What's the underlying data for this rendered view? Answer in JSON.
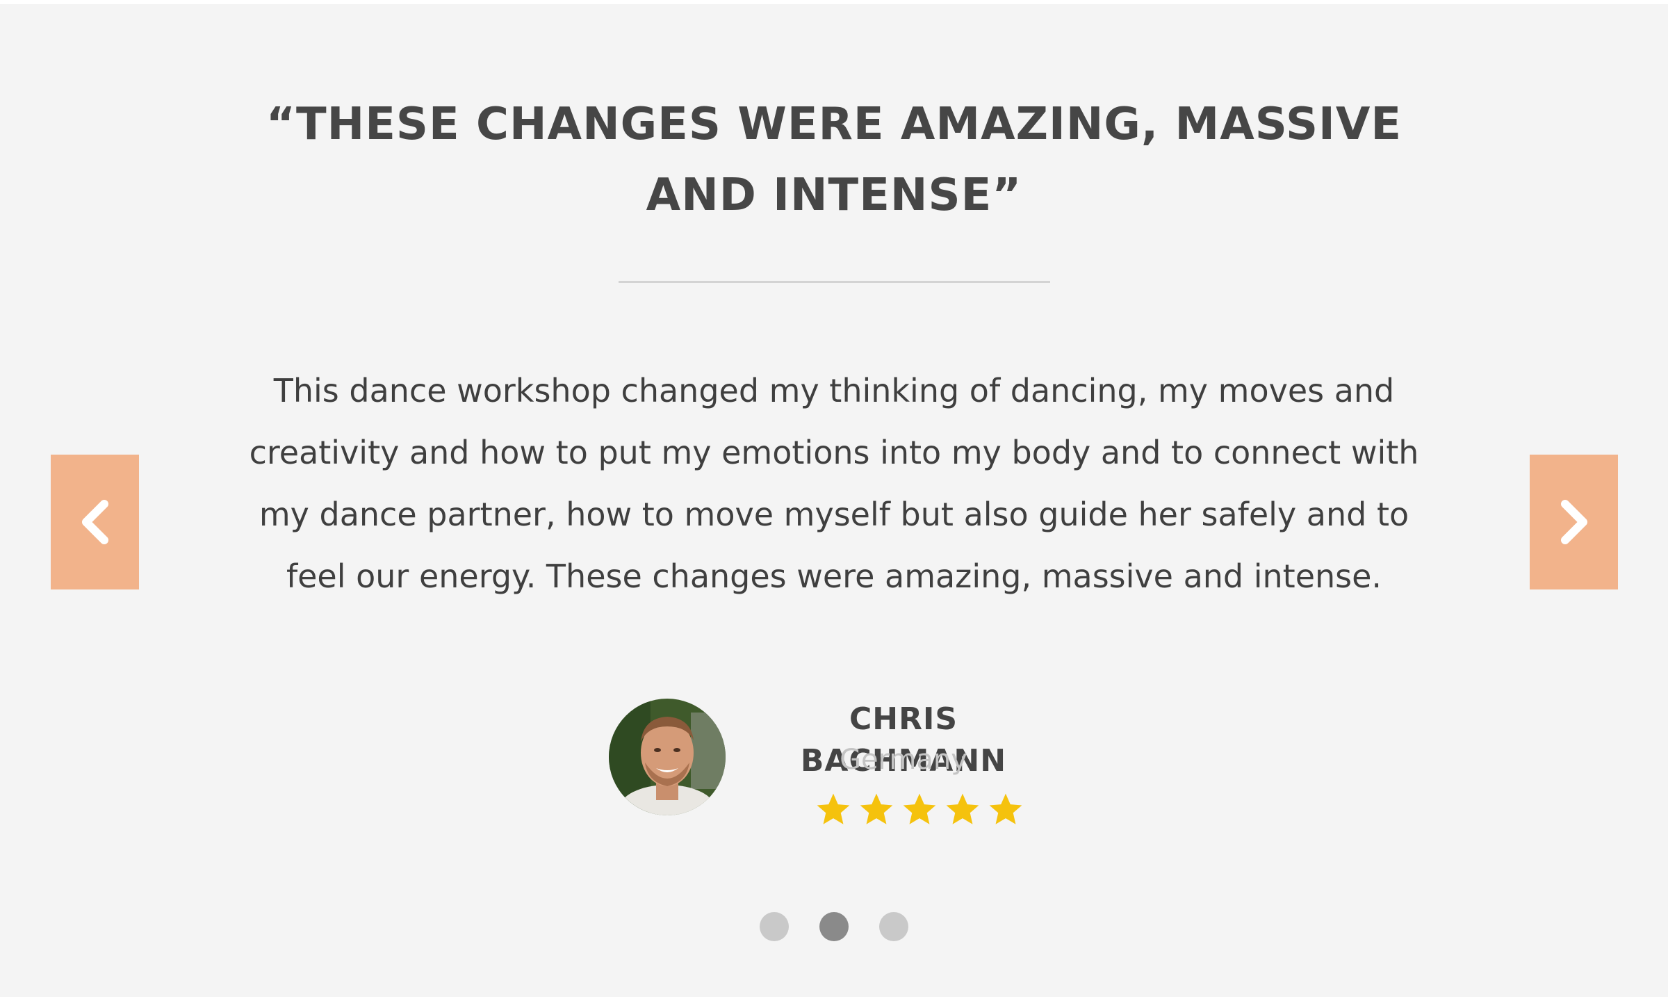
{
  "testimonial": {
    "headline_line1": "“THESE CHANGES WERE AMAZING, MASSIVE",
    "headline_line2": "AND INTENSE”",
    "quote_line1": "This dance workshop changed my thinking of dancing, my moves and",
    "quote_line2": "creativity and how to put my emotions into my body and to connect with",
    "quote_line3": "my dance partner, how to move myself but also guide her safely and to",
    "quote_line4": "feel our energy. These changes were amazing, massive and intense.",
    "author_name": "CHRIS BACHMANN",
    "author_country": "Germany",
    "rating": 5,
    "rating_max": 5
  },
  "navigation": {
    "prev_icon": "chevron-left-icon",
    "next_icon": "chevron-right-icon"
  },
  "pagination": {
    "slide_count": 3,
    "active_slide": 2
  },
  "colors": {
    "background": "#f4f4f4",
    "arrow_button": "#f2b38b",
    "heading_text": "#464646",
    "star": "#f5c20d",
    "dot_inactive": "#c9c9c9",
    "dot_active": "#8a8a8a"
  }
}
